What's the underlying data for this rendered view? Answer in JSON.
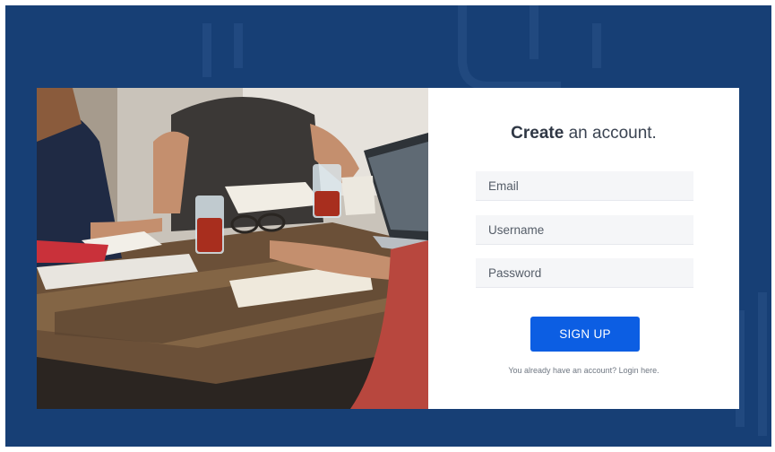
{
  "form": {
    "title_bold": "Create",
    "title_rest": " an account.",
    "email_placeholder": "Email",
    "username_placeholder": "Username",
    "password_placeholder": "Password",
    "submit_label": "SIGN UP",
    "login_prompt": "You already have an account?",
    "login_link": "Login here."
  },
  "colors": {
    "background": "#173f75",
    "button": "#0c5ee3",
    "input_bg": "#f5f6f8"
  }
}
